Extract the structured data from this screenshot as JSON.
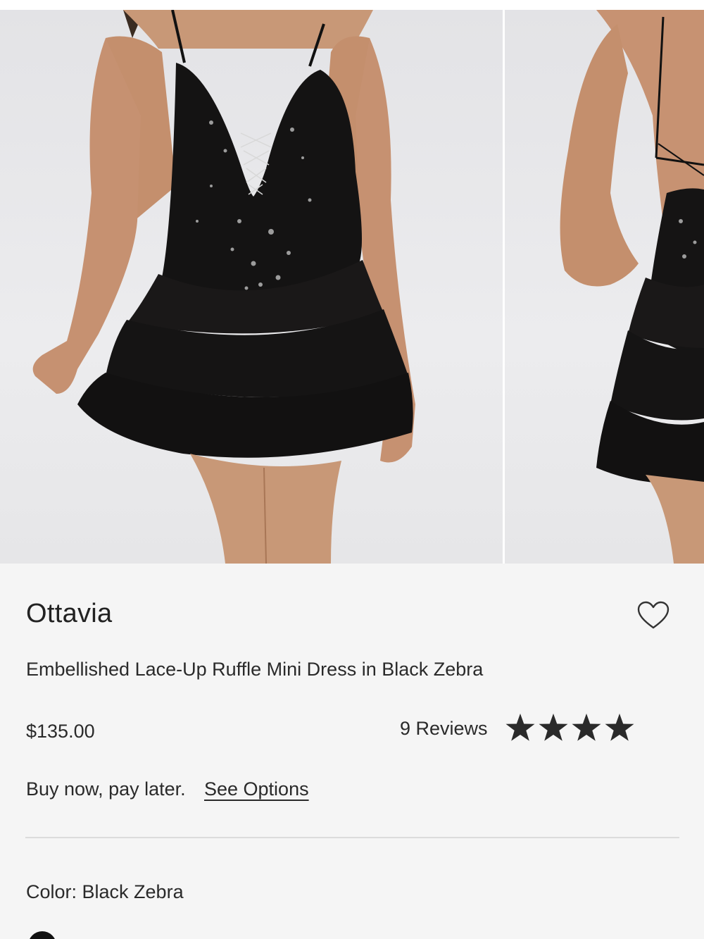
{
  "product": {
    "brand": "Ottavia",
    "name": "Embellished Lace-Up Ruffle Mini Dress in Black Zebra",
    "price": "$135.00",
    "reviews_label": "9 Reviews",
    "rating": 4.7,
    "rating_max": 5,
    "pay_later_text": "Buy now, pay later.",
    "see_options_label": "See Options",
    "color_label": "Color: Black Zebra",
    "swatch_color": "#111111"
  },
  "icons": {
    "wishlist": "heart-outline-icon",
    "star": "star-icon"
  },
  "colors": {
    "background": "#f5f5f5",
    "text": "#222222",
    "stars": "#2a2a2a"
  }
}
